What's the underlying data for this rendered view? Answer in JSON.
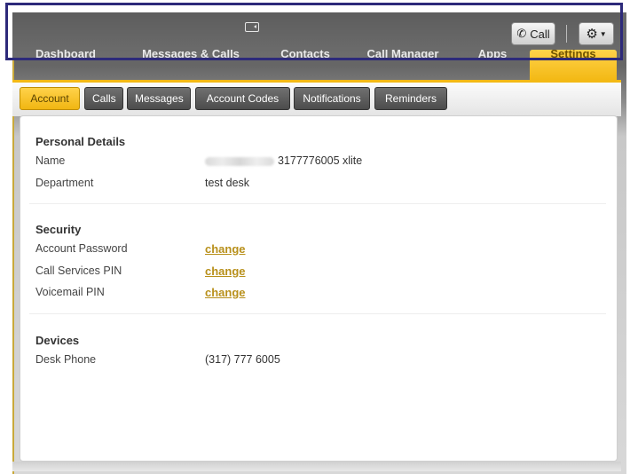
{
  "topbar": {
    "video_icon": "video-icon",
    "call_label": "Call",
    "settings_icon": "gear-icon"
  },
  "nav": {
    "tabs": [
      {
        "label": "Dashboard"
      },
      {
        "label": "Messages & Calls"
      },
      {
        "label": "Contacts"
      },
      {
        "label": "Call Manager"
      },
      {
        "label": "Apps"
      },
      {
        "label": "Settings",
        "active": true
      }
    ]
  },
  "subtabs": [
    {
      "label": "Account",
      "active": true
    },
    {
      "label": "Calls"
    },
    {
      "label": "Messages"
    },
    {
      "label": "Account Codes"
    },
    {
      "label": "Notifications"
    },
    {
      "label": "Reminders"
    }
  ],
  "personal": {
    "title": "Personal Details",
    "name_label": "Name",
    "name_value": "3177776005 xlite",
    "department_label": "Department",
    "department_value": "test desk"
  },
  "security": {
    "title": "Security",
    "account_password_label": "Account Password",
    "call_services_pin_label": "Call Services PIN",
    "voicemail_pin_label": "Voicemail PIN",
    "change_label": "change"
  },
  "devices": {
    "title": "Devices",
    "desk_phone_label": "Desk Phone",
    "desk_phone_value": "(317) 777 6005"
  },
  "colors": {
    "accent": "#f3b915",
    "link": "#b8901b",
    "highlight_frame": "#2d2a7a"
  }
}
